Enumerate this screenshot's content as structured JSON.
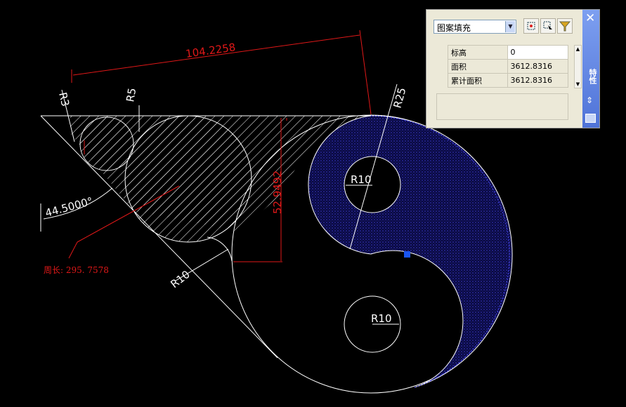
{
  "drawing": {
    "dimensions": {
      "top_length": "104.2258",
      "r3": "R3",
      "r5": "R5",
      "r25": "R25",
      "angle": "44.5000°",
      "vertical": "52.9492",
      "r10_left": "R10",
      "r10_upper": "R10",
      "r10_lower": "R10",
      "perimeter_note": "周长: 295. 7578"
    },
    "colors": {
      "background": "#000000",
      "geometry": "#ffffff",
      "dimension": "#e01818",
      "hatch_fill": "#0d0d55",
      "grip": "#1a55f0"
    }
  },
  "palette": {
    "pattern_select": "图案填充",
    "tool_icons": [
      "quick-select-icon",
      "select-objects-icon",
      "filter-icon"
    ],
    "rows": [
      {
        "label": "标高",
        "value": "0"
      },
      {
        "label": "面积",
        "value": "3612.8316"
      },
      {
        "label": "累计面积",
        "value": "3612.8316"
      }
    ],
    "title": "特性",
    "close": "✕"
  }
}
